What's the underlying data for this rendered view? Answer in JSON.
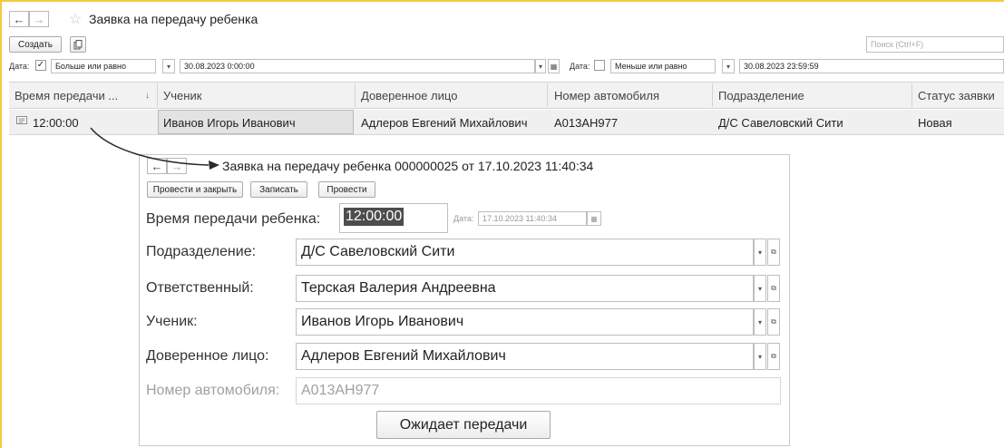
{
  "list_window": {
    "title": "Заявка на передачу ребенка",
    "star_icon": "star-icon",
    "create_label": "Создать",
    "search_placeholder": "Поиск (Ctrl+F)",
    "filter_left": {
      "date_label": "Дата:",
      "checked": true,
      "condition": "Больше или равно",
      "value": "30.08.2023 0:00:00"
    },
    "filter_right": {
      "date_label": "Дата:",
      "checked": false,
      "condition": "Меньше или равно",
      "value": "30.08.2023 23:59:59"
    },
    "columns": [
      "Время передачи ...",
      "Ученик",
      "Доверенное лицо",
      "Номер автомобиля",
      "Подразделение",
      "Статус заявки"
    ],
    "sort_indicator": "↓",
    "rows": [
      {
        "time": "12:00:00",
        "student": "Иванов Игорь Иванович",
        "trusted": "Адлеров Евгений Михайлович",
        "car": "А013АН977",
        "division": "Д/С Савеловский Сити",
        "status": "Новая"
      }
    ]
  },
  "document_form": {
    "title": "Заявка на передачу ребенка 000000025 от 17.10.2023 11:40:34",
    "buttons": {
      "post_close": "Провести и закрыть",
      "save": "Записать",
      "post": "Провести"
    },
    "time_label": "Время передачи ребенка:",
    "time_value": "12:00:00",
    "date_label": "Дата:",
    "date_value": "17.10.2023 11:40:34",
    "fields": [
      {
        "label": "Подразделение:",
        "value": "Д/С Савеловский Сити"
      },
      {
        "label": "Ответственный:",
        "value": "Терская Валерия Андреевна"
      },
      {
        "label": "Ученик:",
        "value": "Иванов Игорь Иванович"
      },
      {
        "label": "Доверенное лицо:",
        "value": "Адлеров Евгений Михайлович"
      }
    ],
    "car_label": "Номер автомобиля:",
    "car_value": "А013АН977",
    "status_button": "Ожидает передачи"
  },
  "colors": {
    "accent_border": "#f2c94c",
    "selected_cell": "#e6e6e6",
    "time_highlight": "#4d4d4d"
  }
}
